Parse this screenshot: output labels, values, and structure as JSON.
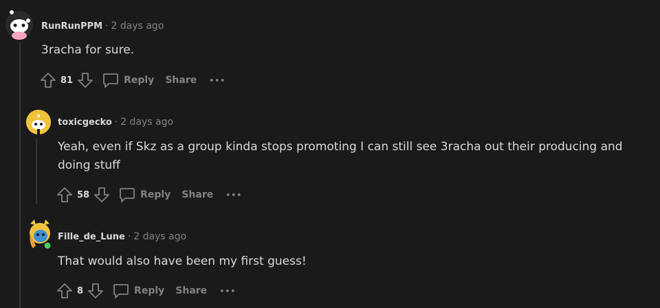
{
  "comments": [
    {
      "username": "RunRunPPM",
      "separator": "·",
      "time": "2 days ago",
      "body": "3racha for sure.",
      "score": "81",
      "reply_label": "Reply",
      "share_label": "Share",
      "more_label": "•••"
    },
    {
      "username": "toxicgecko",
      "separator": "·",
      "time": "2 days ago",
      "body": "Yeah, even if Skz as a group kinda stops promoting I can still see 3racha out their producing and doing stuff",
      "score": "58",
      "reply_label": "Reply",
      "share_label": "Share",
      "more_label": "•••"
    },
    {
      "username": "Fille_de_Lune",
      "separator": "·",
      "time": "2 days ago",
      "body": "That would also have been my first guess!",
      "score": "8",
      "reply_label": "Reply",
      "share_label": "Share",
      "more_label": "•••"
    }
  ],
  "colors": {
    "background": "#1a1a1b",
    "text": "#d7dadc",
    "muted": "#818384",
    "online": "#46d160"
  }
}
